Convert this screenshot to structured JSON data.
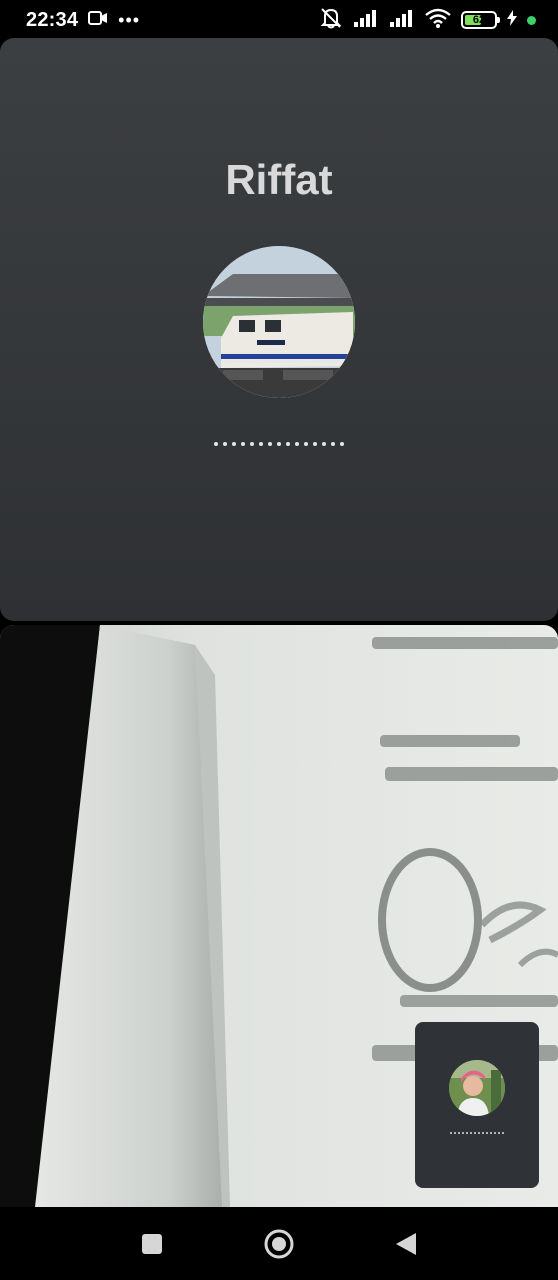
{
  "status_bar": {
    "time": "22:34",
    "overflow_dots": "•••",
    "battery_percent": "62",
    "battery_level": 0.62,
    "icons": [
      "video-recording-icon",
      "silent-bell-icon",
      "signal-icon",
      "signal-icon",
      "wifi-icon",
      "battery-icon",
      "charging-icon"
    ]
  },
  "call": {
    "callee_name": "Riffat",
    "status_dots": "...............",
    "avatar_icon": "contact-avatar"
  },
  "pip": {
    "status_dots": ".............."
  },
  "nav_bar": {
    "icons": [
      "recents-square-icon",
      "home-circle-icon",
      "back-triangle-icon"
    ]
  },
  "colors": {
    "panel_bg": "#35383b",
    "battery_green": "#7ee05c",
    "indicator_green": "#3bd06b"
  }
}
